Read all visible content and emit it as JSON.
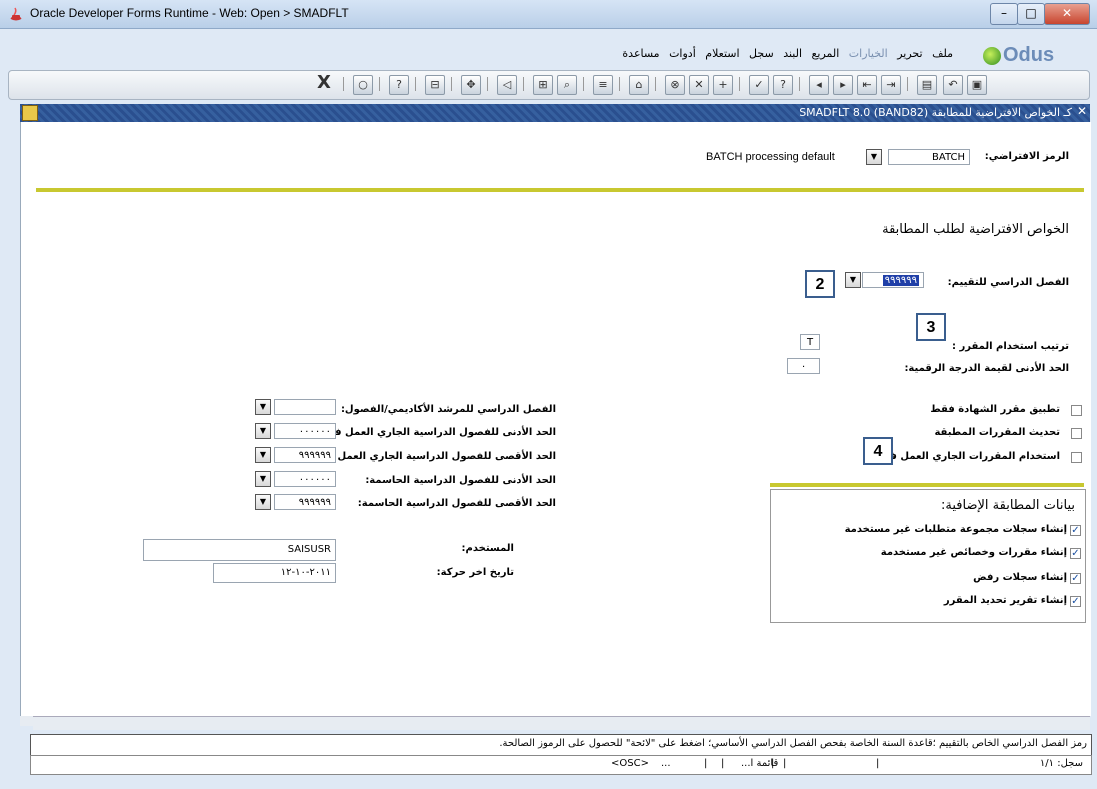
{
  "window": {
    "title": "Oracle Developer Forms Runtime - Web:  Open > SMADFLT"
  },
  "menu": {
    "items": [
      "ملف",
      "تحرير",
      "الخيارات",
      "المريع",
      "البند",
      "سجل",
      "استعلام",
      "أدوات",
      "مساعدة"
    ],
    "logo": "Odus"
  },
  "toolbar": {
    "exit": "X"
  },
  "form": {
    "title": "كـ الخواص الافتراضية للمطابقة  (SMADFLT 8.0  (BAND82",
    "default_code_label": "الرمز الافتراضي:",
    "default_code_value": "BATCH",
    "default_code_desc": "BATCH processing default",
    "section_title": "الخواص الافتراضية لطلب المطابقة",
    "eval_term_label": "الفصل الدراسي للتقييم:",
    "eval_term_value": "٩٩٩٩٩٩",
    "course_usage_label": "ترتيب استخدام المقرر :",
    "course_usage_value": "T",
    "min_grade_label": "الحد الأدنى لقيمة الدرجة الرقمية:",
    "min_grade_value": "٠",
    "checkboxes": [
      {
        "label": "تطبيق مقرر الشهادة فقط",
        "checked": false
      },
      {
        "label": "تحديث المقررات المطبقة",
        "checked": false
      },
      {
        "label": "استخدام المقررات الجاري العمل فيها",
        "checked": false
      }
    ],
    "left_fields": [
      {
        "label": "الفصل الدراسي للمرشد الأكاديمي/الفصول:",
        "value": ""
      },
      {
        "label": "الحد الأدنى للفصول الدراسية الجاري العمل فيها:",
        "value": "٠٠٠٠٠٠"
      },
      {
        "label": "الحد الأقصى للفصول الدراسية الجاري العمل فيها:",
        "value": "٩٩٩٩٩٩"
      },
      {
        "label": "الحد الأدنى للفصول الدراسية الحاسمة:",
        "value": "٠٠٠٠٠٠"
      },
      {
        "label": "الحد الأقصى للفصول الدراسية الحاسمة:",
        "value": "٩٩٩٩٩٩"
      }
    ],
    "user_label": "المستخدم:",
    "user_value": "SAISUSR",
    "activity_label": "تاريخ اخر حركة:",
    "activity_value": "٢٠١١-١٠-١٢",
    "extra_title": "بيانات المطابقة الإضافية:",
    "extra_items": [
      {
        "label": "إنشاء سجلات مجموعة متطلبات غير مستخدمة",
        "checked": true
      },
      {
        "label": "إنشاء مقررات وخصائص غير مستخدمة",
        "checked": true
      },
      {
        "label": "إنشاء سجلات رفض",
        "checked": true
      },
      {
        "label": "إنشاء تقرير تحديد المقرر",
        "checked": true
      }
    ]
  },
  "callouts": [
    "2",
    "3",
    "4"
  ],
  "status": {
    "hint": "رمز الفصل الدراسي الخاص بالتقييم ؛قاعدة السنة الخاصة بفحص الفصل الدراسي الأساسي؛ اضغط على \"لائحة\" للحصول على الرموز الصالحة.",
    "record": "سجل: ١/١",
    "list": "قائمة ا...",
    "ellipsis": "...",
    "osc": "<OSC>"
  },
  "colors": {
    "form_bar": "#2a4f8f",
    "separator": "#c8c830",
    "callout_border": "#3a5e8e"
  }
}
